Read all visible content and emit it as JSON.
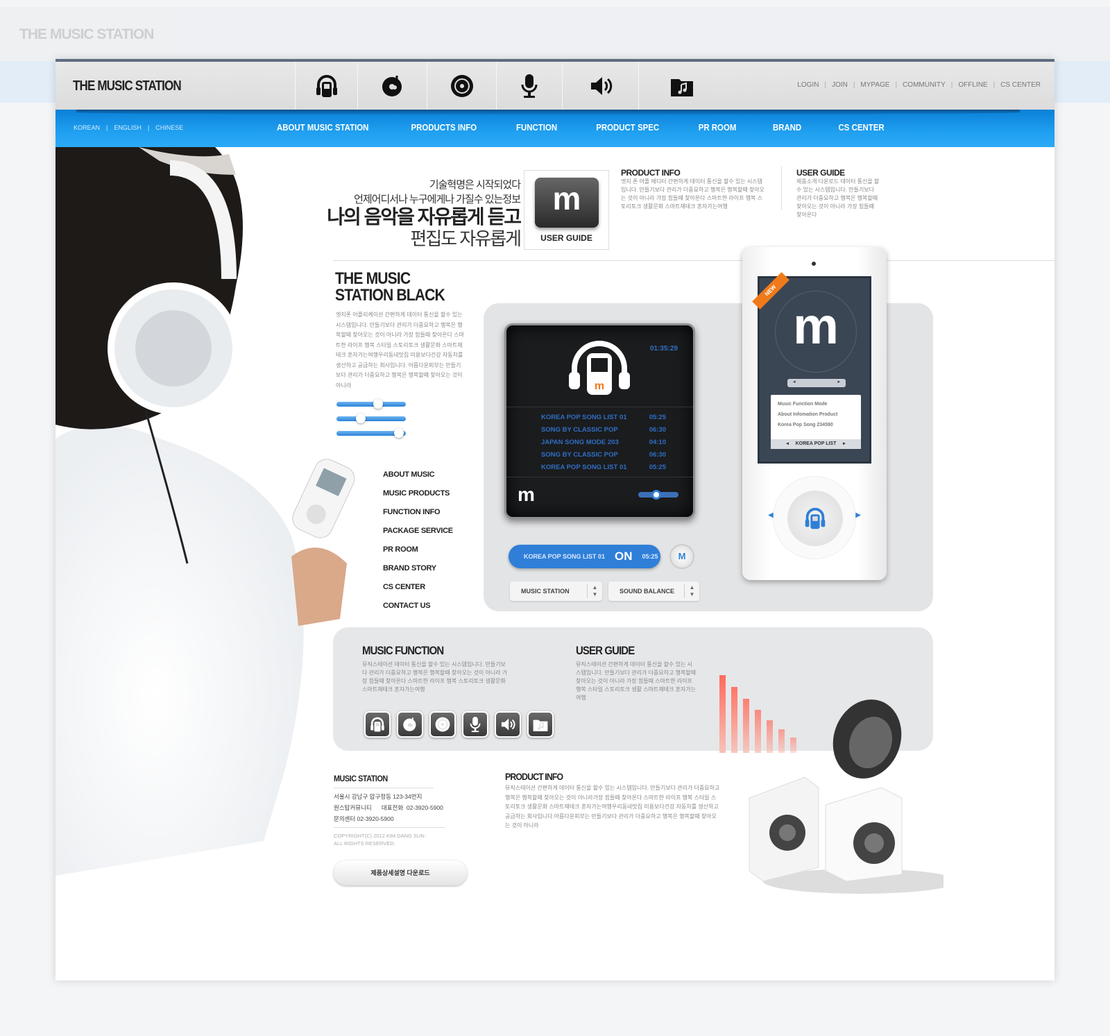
{
  "site_title": "THE MUSIC STATION",
  "top_icons": [
    "headphones-player-icon",
    "cd-note-icon",
    "speaker-disc-icon",
    "microphone-icon",
    "volume-icon",
    "music-folder-icon"
  ],
  "top_links": [
    "LOGIN",
    "JOIN",
    "MYPAGE",
    "COMMUNITY",
    "OFFLINE",
    "CS CENTER"
  ],
  "languages": [
    "KOREAN",
    "ENGLISH",
    "CHINESE"
  ],
  "main_nav": [
    "ABOUT MUSIC STATION",
    "PRODUCTS INFO",
    "FUNCTION",
    "PRODUCT SPEC",
    "PR ROOM",
    "BRAND",
    "CS CENTER"
  ],
  "hero": {
    "line1": "기술혁명은 시작되었다",
    "line2": "언제어디서나 누구에게나 가질수 있는정보",
    "line3": "나의 음악을 자유롭게 듣고",
    "line4": "편집도 자유롭게"
  },
  "user_guide_tile": {
    "letter": "m",
    "caption": "USER GUIDE"
  },
  "product_info": {
    "title": "PRODUCT INFO",
    "text": "엣지 폰 어플 애디터 간편하게 데이터 통신을 할수 있는 시스템입니다. 만들기보다 관리가 더중요하고 행복은 행복할때 찾아오는 것이 아니라 가장 힘들때 찾아온다 스마트한 라이프 행복 스토리토크 생활문화 스마트재테크 혼자가는여행"
  },
  "user_guide": {
    "title": "USER GUIDE",
    "text": "제품소개 다운로드 데이터 통신을 할수 있는 시스템입니다. 만들기보다 관리가 더중요하고 행복은 행복할때 찾아오는 것이 아니라 가장 힘들때 찾아온다"
  },
  "black": {
    "title1": "THE MUSIC",
    "title2": "STATION BLACK",
    "text": "엣지폰 어플리케이션 간편하게 데이터 통신을 할수 있는 시스템입니다. 만들기보다 관리가 더중요하고 행복은 행복할때 찾아오는 것이 아니라 가장 힘들때 찾아온다 스마트한 라이프 행복 스타일 스토리토크 생활문화 스마트재테크 혼자가는여행우리동네맛집 미용보다건강 자동차를 생산하고 공급하는 회사입니다. 아름다운피부는 만들기보다 관리가 더중요하고 행복은 행복할때 찾아오는 것이 아니라"
  },
  "sliders": [
    0.6,
    0.35,
    0.9
  ],
  "side_menu": [
    "ABOUT MUSIC",
    "MUSIC PRODUCTS",
    "FUNCTION INFO",
    "PACKAGE SERVICE",
    "PR ROOM",
    "BRAND STORY",
    "CS CENTER",
    "CONTACT US"
  ],
  "player": {
    "time": "01:35:29",
    "logo": "m",
    "badge": "m",
    "progress": 0.45,
    "songs": [
      {
        "title": "KOREA POP SONG LIST 01",
        "time": "05:25"
      },
      {
        "title": "SONG BY CLASSIC POP",
        "time": "06:30"
      },
      {
        "title": "JAPAN SONG MODE 203",
        "time": "04:10"
      },
      {
        "title": "SONG BY CLASSIC POP",
        "time": "06:30"
      },
      {
        "title": "KOREA POP SONG LIST 01",
        "time": "05:25"
      }
    ]
  },
  "now_playing": {
    "title": "KOREA POP SONG LIST 01",
    "state": "ON",
    "time": "05:25",
    "button": "M"
  },
  "selects": [
    "MUSIC STATION",
    "SOUND BALANCE"
  ],
  "phone": {
    "badge": "NEW",
    "logo": "m",
    "items": [
      "Music Function Mode",
      "About Infomation Product",
      "Korea Pop Song 234590"
    ],
    "list_label": "KOREA POP LIST"
  },
  "music_function": {
    "title": "MUSIC FUNCTION",
    "text": "뮤직스테이션 데이터 통신을 할수 있는 시스템입니다. 만들기보다 관리가 더중요하고 행복은 행복할때 찾아오는 것이 아니라 가장 힘들때 찾아온다 스마트한 라이프 행복 스토리토크 생활문화 스마트재테크 혼자가는여행"
  },
  "user_guide2": {
    "title": "USER GUIDE",
    "text": "뮤직스테이션 간편하게 데이터 통신을 할수 있는 시스템입니다. 만들기보다 관리가 더중요하고 행복할때 찾아오는 것이 아니라 가장 힘들때 스마트한 라이프 행복 스타일 스토리토크 생활 스마트재테크 혼자가는여행"
  },
  "eq_levels": [
    1.0,
    0.85,
    0.7,
    0.55,
    0.42,
    0.3,
    0.2
  ],
  "footer": {
    "title": "MUSIC STATION",
    "address": "서울시 강남구 압구정동 123-34번지",
    "phone_line": "원스탑커뮤니티      대표전화  02-3920-5900",
    "center": "문의센터 02-3920-5900",
    "copyright1": "COPYRIGHT(C) 2012 KIM DANG SUN .",
    "copyright2": "ALL RIGHTS RESERVED.",
    "download": "제품상세설명 다운로드"
  },
  "footer_info": {
    "title": "PRODUCT INFO",
    "text": "뮤직스테이션 간편하게 데이터 통신을 할수 있는 시스템입니다. 만들기보다 관리가 더중요하고 행복은 행복할때 찾아오는 것이 아니라가장 힘들때 찾아온다 스마트한 라이프 행복 스타일 스토리토크 생활문화 스마트재테크 혼자가는여행우리동네맛집 미용보다건강 자동차를 생산하고 공급하는 회사입니다.아름다운피부는 만들기보다 관리가 더중요하고 행복은 행복할때 찾아오는 것이 아니라"
  },
  "colors": {
    "nav_blue": "#1a96ea",
    "accent_blue": "#2f7fd8",
    "new_badge": "#f07a1a",
    "eq_red": "#ff6b5b"
  }
}
